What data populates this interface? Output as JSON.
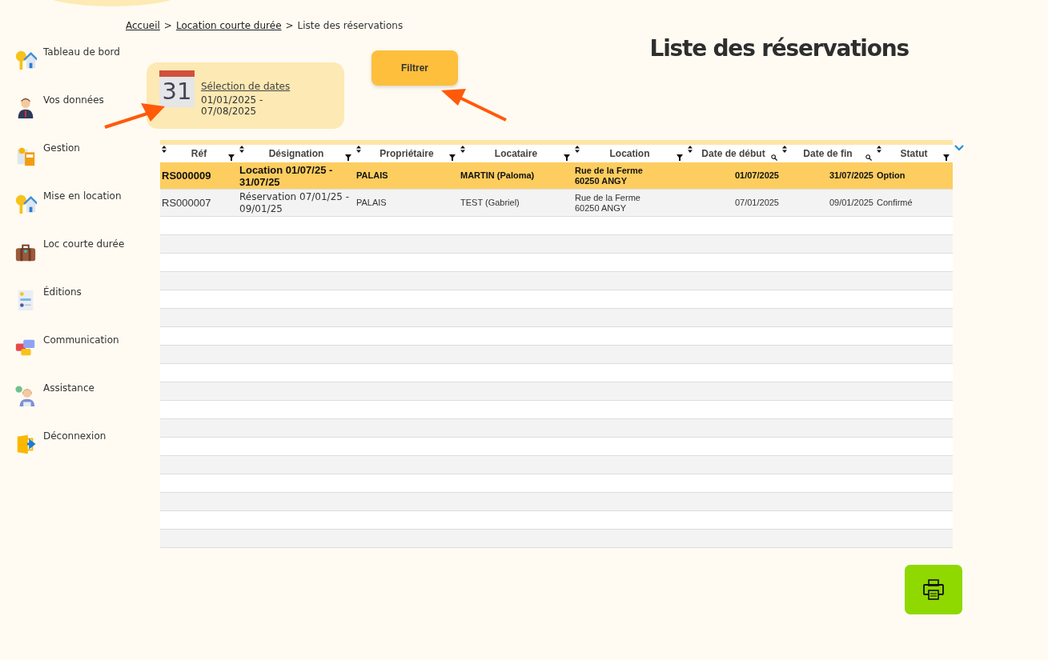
{
  "breadcrumb": [
    {
      "label": "Accueil",
      "kind": "link"
    },
    {
      "label": "Location courte durée",
      "kind": "link"
    },
    {
      "label": "Liste des réservations",
      "kind": "current"
    }
  ],
  "breadcrumb_separator": ">",
  "sidebar": {
    "items": [
      {
        "label": "Tableau de bord"
      },
      {
        "label": "Vos données"
      },
      {
        "label": "Gestion"
      },
      {
        "label": "Mise en location"
      },
      {
        "label": "Loc courte durée"
      },
      {
        "label": "Éditions"
      },
      {
        "label": "Communication"
      },
      {
        "label": "Assistance"
      },
      {
        "label": "Déconnexion"
      }
    ]
  },
  "page_title": "Liste des réservations",
  "date_selector": {
    "day": "31",
    "link": "Sélection de dates",
    "range_start": "01/01/2025 -",
    "range_end": "07/08/2025"
  },
  "filter_button": "Filtrer",
  "table": {
    "columns": [
      {
        "label": "Réf",
        "kind": "filter"
      },
      {
        "label": "Désignation",
        "kind": "filter"
      },
      {
        "label": "Propriétaire",
        "kind": "filter"
      },
      {
        "label": "Locataire",
        "kind": "filter"
      },
      {
        "label": "Location",
        "kind": "filter"
      },
      {
        "label": "Date de début",
        "kind": "search"
      },
      {
        "label": "Date de fin",
        "kind": "search"
      },
      {
        "label": "Statut",
        "kind": "filter"
      }
    ],
    "rows": [
      {
        "selected": true,
        "cells": [
          "RS000009",
          "Location 01/07/25 - 31/07/25",
          "PALAIS",
          "MARTIN (Paloma)",
          "Rue de la Ferme\n60250 ANGY",
          "01/07/2025",
          "31/07/2025",
          "Option"
        ]
      },
      {
        "selected": false,
        "cells": [
          "RS000007",
          "Réservation 07/01/25 - 09/01/25",
          "PALAIS",
          "TEST (Gabriel)",
          "Rue de la Ferme\n60250 ANGY",
          "07/01/2025",
          "09/01/2025",
          "Confirmé"
        ]
      }
    ]
  }
}
